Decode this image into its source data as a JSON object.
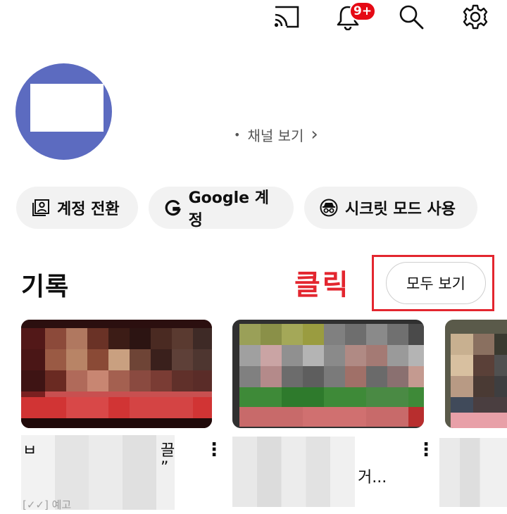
{
  "header": {
    "cast_icon": "cast-icon",
    "notification_icon": "bell-icon",
    "notification_badge": "9+",
    "search_icon": "search-icon",
    "settings_icon": "gear-icon"
  },
  "profile": {
    "channel_link": "채널 보기",
    "channel_bullet": "•",
    "channel_chevron": "›"
  },
  "chips": [
    {
      "label": "계정 전환",
      "icon": "switch-account-icon"
    },
    {
      "label": "Google 계정",
      "icon": "google-g-icon"
    },
    {
      "label": "시크릿 모드 사용",
      "icon": "incognito-icon"
    }
  ],
  "history": {
    "title": "기록",
    "annotation": "클릭",
    "view_all": "모두 보기",
    "items": [
      {
        "title_start": "ㅂ",
        "title_end_1": "끌",
        "title_end_2": "”",
        "tag": "[✓✓] 예고"
      },
      {
        "title_end": "거..."
      },
      {}
    ]
  },
  "colors": {
    "accent": "#e3262f",
    "badge": "#e50914",
    "avatar": "#5c6bc0",
    "chip_bg": "#f2f2f2"
  }
}
